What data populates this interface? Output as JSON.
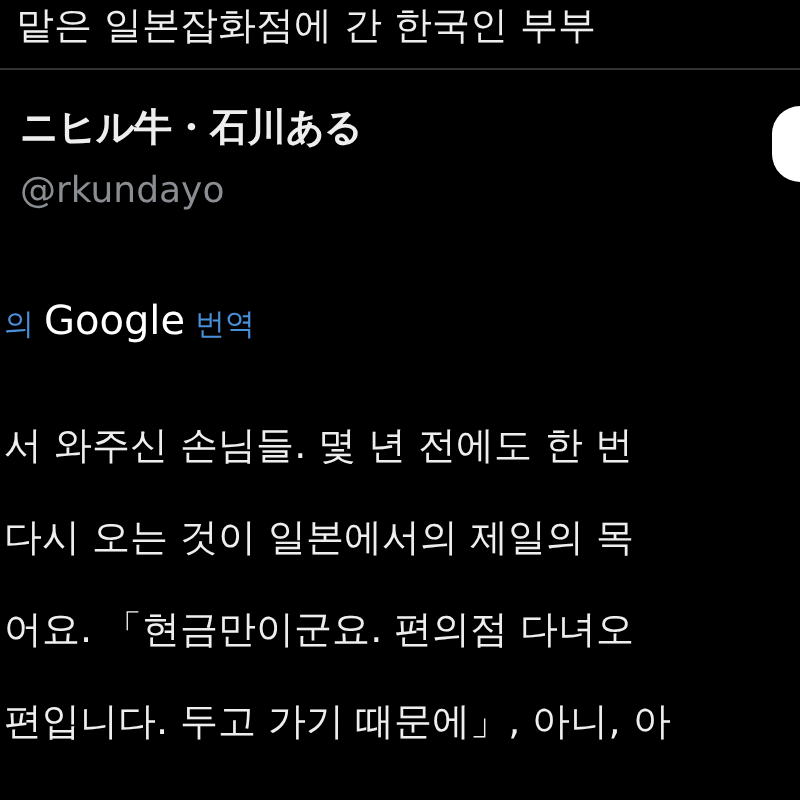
{
  "headline": "맡은 일본잡화점에 간 한국인 부부",
  "tweet": {
    "author_name": "ニヒル牛・石川ある",
    "handle": "@rkundayo",
    "translation": {
      "prefix": "의",
      "provider": "Google",
      "action": "번역"
    },
    "lines": [
      "서 와주신 손님들. 몇 년 전에도 한 번",
      "다시 오는 것이 일본에서의 제일의 목",
      "어요. 「현금만이군요. 편의점 다녀오",
      "편입니다. 두고 가기 때문에」, 아니, 아"
    ]
  }
}
